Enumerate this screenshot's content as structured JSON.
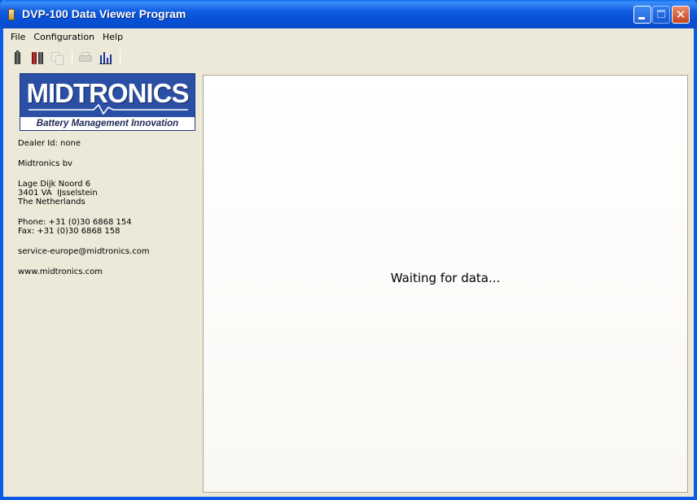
{
  "window": {
    "title": "DVP-100 Data Viewer Program",
    "icon": "app-icon",
    "controls": [
      "minimize-icon",
      "maximize-icon",
      "close-icon"
    ],
    "close_glyph": "✕"
  },
  "menu": {
    "items": [
      "File",
      "Configuration",
      "Help"
    ]
  },
  "toolbar": {
    "buttons": [
      {
        "icon": "battery-icon",
        "enabled": true
      },
      {
        "icon": "batteries-icon",
        "enabled": true
      },
      {
        "icon": "copy-icon",
        "enabled": false
      },
      {
        "icon": "printer-icon",
        "enabled": false
      },
      {
        "icon": "bar-chart-icon",
        "enabled": true
      }
    ]
  },
  "sidebar": {
    "logo": {
      "brand": "MIDTRONICS",
      "tagline": "Battery Management Innovation",
      "colors": {
        "background": "#2a4fa4",
        "text": "#ffffff",
        "tagline": "#1e2a55"
      }
    },
    "dealer": "Dealer Id: none",
    "company": "Midtronics bv",
    "address": [
      "Lage Dijk Noord 6",
      "3401 VA  IJsselstein",
      "The Netherlands"
    ],
    "phone": "Phone: +31 (0)30 6868 154",
    "fax": "Fax: +31 (0)30 6868 158",
    "email": "service-europe@midtronics.com",
    "website": "www.midtronics.com"
  },
  "main": {
    "status": "Waiting for data..."
  },
  "colors": {
    "titlebar": "#0a5ce6",
    "window_bg": "#ece9d8",
    "close_button": "#c8431f"
  }
}
